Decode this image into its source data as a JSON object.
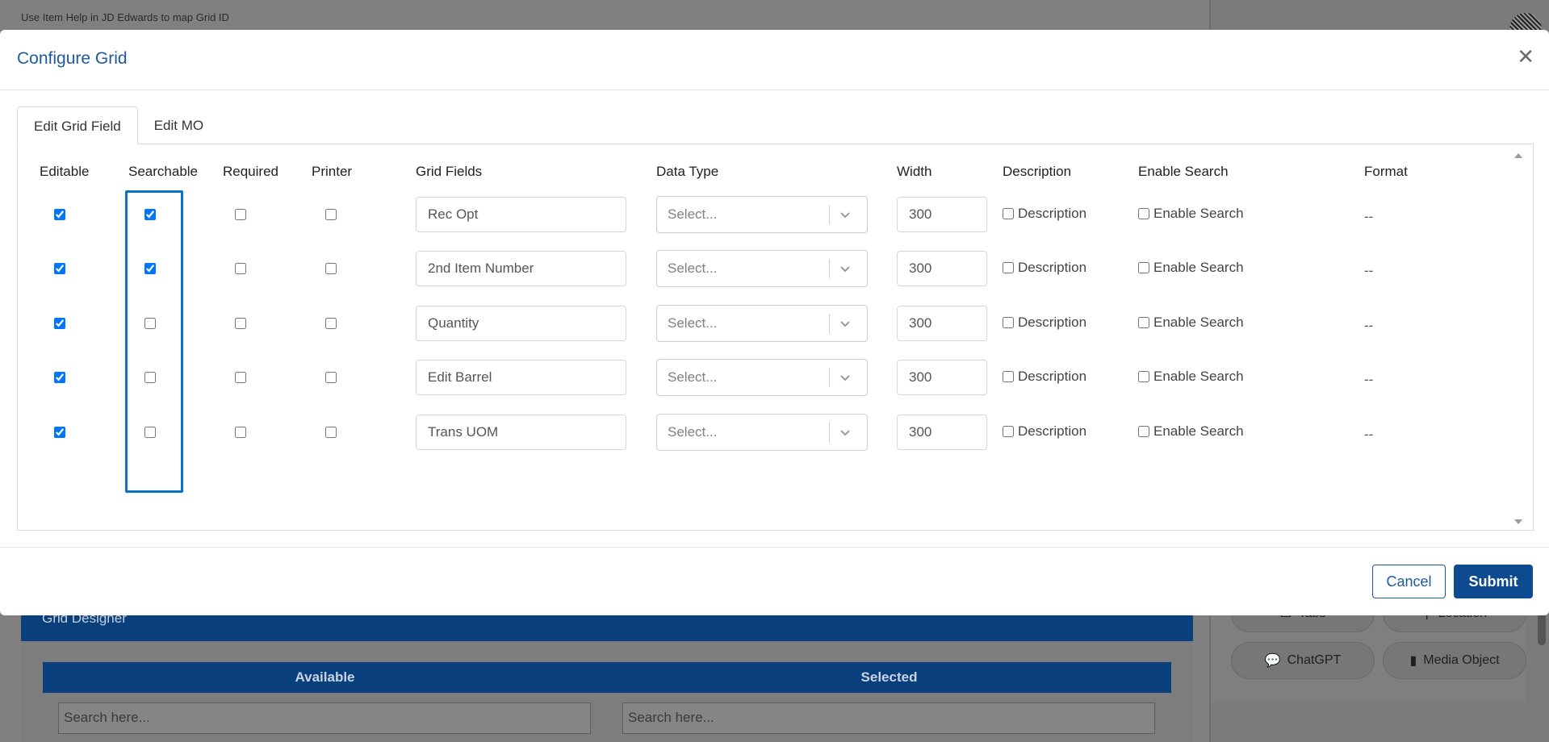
{
  "background": {
    "hint_text": "Use Item Help in JD Edwards to map Grid ID",
    "grid_designer_title": "Grid Designer",
    "available_label": "Available",
    "selected_label": "Selected",
    "search_placeholder_left": "Search here...",
    "search_placeholder_right": "Search here...",
    "pills": [
      {
        "label": "Tabs",
        "icon": "tabs-icon"
      },
      {
        "label": "Location",
        "icon": "location-pin-icon"
      },
      {
        "label": "ChatGPT",
        "icon": "chat-bubble-icon"
      },
      {
        "label": "Media Object",
        "icon": "file-icon"
      }
    ]
  },
  "modal": {
    "title": "Configure Grid",
    "close_icon": "close-icon",
    "tabs": [
      {
        "label": "Edit Grid Field",
        "active": true
      },
      {
        "label": "Edit MO",
        "active": false
      }
    ],
    "columns": {
      "editable": "Editable",
      "searchable": "Searchable",
      "required": "Required",
      "printer": "Printer",
      "grid_fields": "Grid Fields",
      "data_type": "Data Type",
      "width": "Width",
      "description": "Description",
      "enable_search": "Enable Search",
      "format": "Format"
    },
    "rows": [
      {
        "editable": true,
        "searchable": true,
        "required": false,
        "printer": false,
        "field": "Rec Opt",
        "data_type": "Select...",
        "width": "300",
        "description_label": "Description",
        "enable_search_label": "Enable Search",
        "format": "--"
      },
      {
        "editable": true,
        "searchable": true,
        "required": false,
        "printer": false,
        "field": "2nd Item Number",
        "data_type": "Select...",
        "width": "300",
        "description_label": "Description",
        "enable_search_label": "Enable Search",
        "format": "--"
      },
      {
        "editable": true,
        "searchable": false,
        "required": false,
        "printer": false,
        "field": "Quantity",
        "data_type": "Select...",
        "width": "300",
        "description_label": "Description",
        "enable_search_label": "Enable Search",
        "format": "--"
      },
      {
        "editable": true,
        "searchable": false,
        "required": false,
        "printer": false,
        "field": "Edit Barrel",
        "data_type": "Select...",
        "width": "300",
        "description_label": "Description",
        "enable_search_label": "Enable Search",
        "format": "--"
      },
      {
        "editable": true,
        "searchable": false,
        "required": false,
        "printer": false,
        "field": "Trans UOM",
        "data_type": "Select...",
        "width": "300",
        "description_label": "Description",
        "enable_search_label": "Enable Search",
        "format": "--"
      }
    ],
    "footer": {
      "cancel_label": "Cancel",
      "submit_label": "Submit"
    }
  },
  "colors": {
    "accent": "#1d5a9c",
    "primary_button": "#0e4a8f",
    "highlight_border": "#0a74c4",
    "checkbox_checked": "#1a73e8"
  }
}
